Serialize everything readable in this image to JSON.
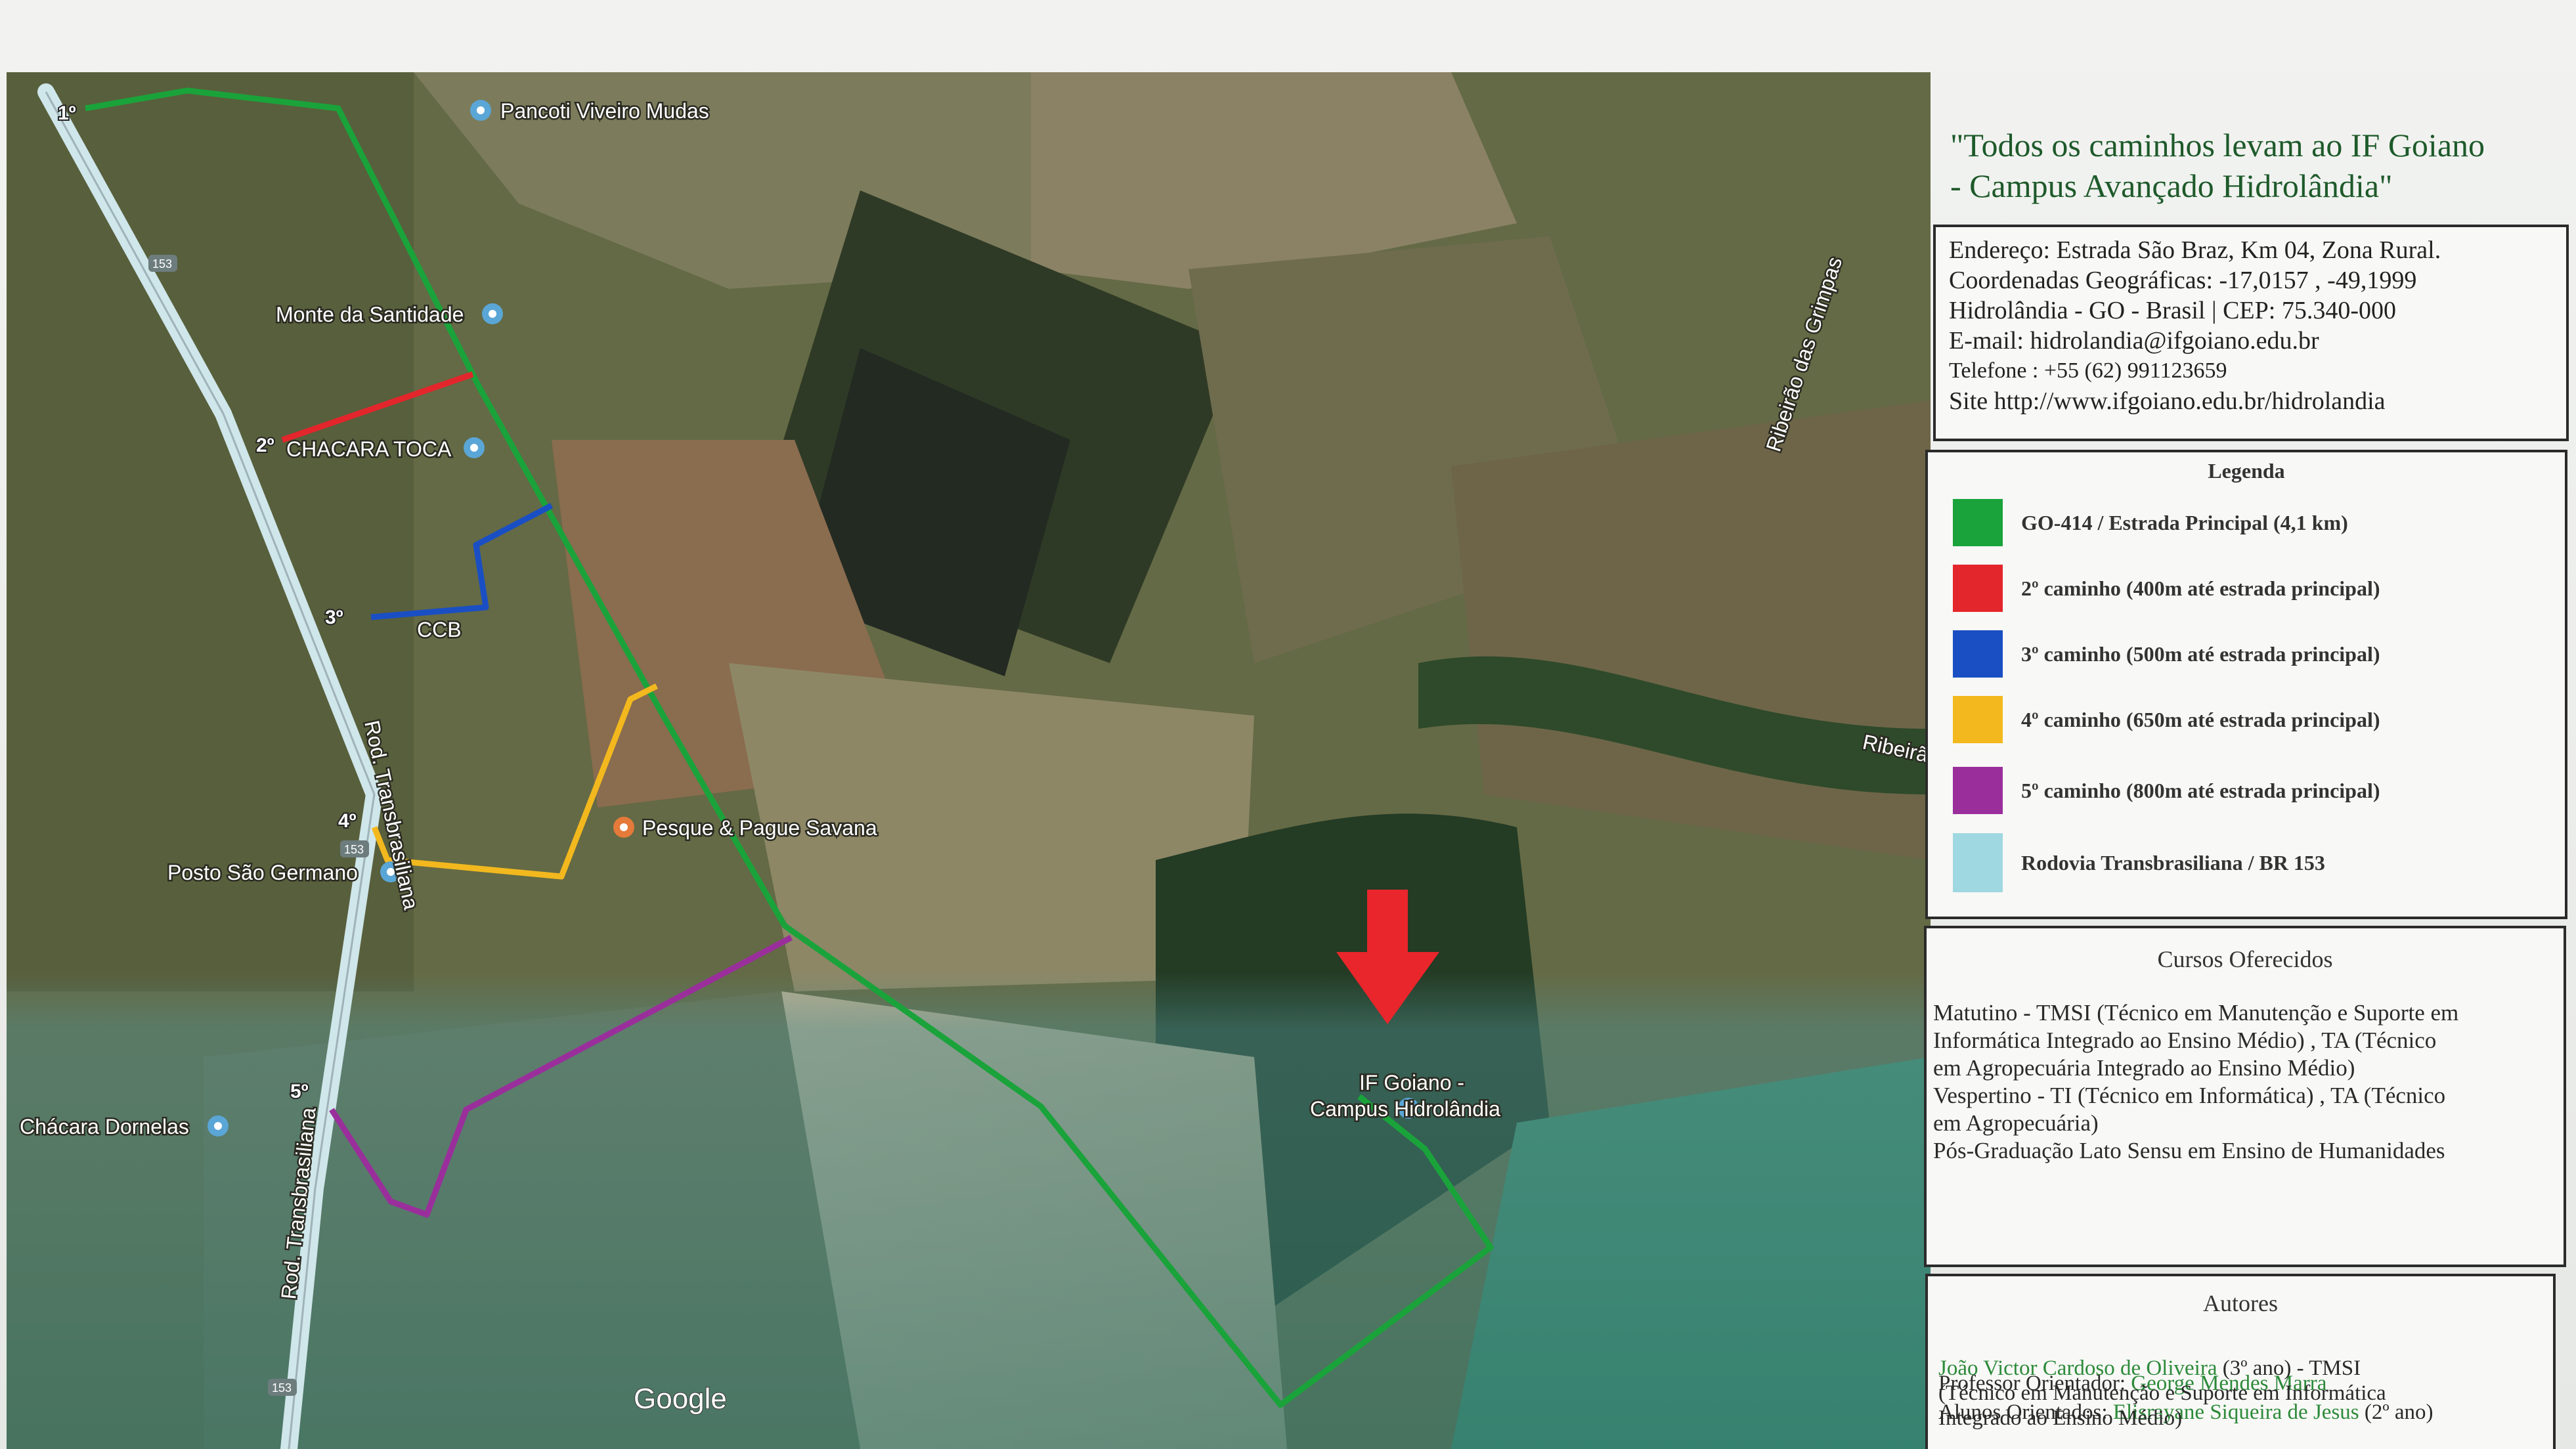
{
  "map": {
    "watermark": "Google",
    "markers": [
      "1º",
      "2º",
      "3º",
      "4º",
      "5º"
    ],
    "places": {
      "pancoti": "Pancoti Viveiro Mudas",
      "monte": "Monte da Santidade",
      "chacara_toca": "CHACARA TOCA",
      "ccb": "CCB",
      "pesque": "Pesque & Pague Savana",
      "posto": "Posto São Germano",
      "dornelas": "Chácara Dornelas",
      "campus_l1": "IF Goiano -",
      "campus_l2": "Campus Hidrolândia",
      "ribeirao1": "Ribeirão das Grimpas",
      "ribeirao2": "Ribeirã",
      "rod1": "Rod. Transbrasiliana",
      "rod2": "Rod. Transbrasiliana"
    },
    "shields": [
      "153",
      "153",
      "153"
    ]
  },
  "panel": {
    "title_l1": "\"Todos os caminhos levam ao IF Goiano",
    "title_l2": "- Campus Avançado Hidrolândia\"",
    "address": [
      "Endereço: Estrada São Braz, Km 04, Zona Rural.",
      "Coordenadas Geográficas: -17,0157 , -49,1999",
      "Hidrolândia - GO - Brasil  |  CEP: 75.340-000",
      "E-mail: hidrolandia@ifgoiano.edu.br",
      "Telefone : +55 (62) 991123659",
      "Site http://www.ifgoiano.edu.br/hidrolandia"
    ],
    "legend": {
      "heading": "Legenda",
      "items": [
        {
          "label": "GO-414 / Estrada Principal (4,1 km)",
          "color": "#1aa33a"
        },
        {
          "label": "2º caminho (400m até estrada principal)",
          "color": "#e3262c"
        },
        {
          "label": "3º caminho (500m até estrada principal)",
          "color": "#1a4fc4"
        },
        {
          "label": "4º caminho (650m até estrada principal)",
          "color": "#f2b81e"
        },
        {
          "label": "5º caminho (800m até estrada principal)",
          "color": "#9a2f9c"
        },
        {
          "label": "Rodovia Transbrasiliana / BR 153",
          "color": "#9fd8e0"
        }
      ]
    },
    "courses": {
      "heading": "Cursos Oferecidos",
      "lines": [
        "Matutino - TMSI (Técnico em Manutenção e Suporte em",
        "Informática Integrado ao Ensino Médio) , TA (Técnico",
        "em Agropecuária Integrado ao Ensino Médio)",
        "Vespertino - TI (Técnico em Informática) , TA (Técnico",
        "em Agropecuária)",
        "Pós-Graduação Lato Sensu em Ensino de Humanidades"
      ]
    },
    "authors": {
      "heading": "Autores",
      "advisor_prefix": "Professor Orientador: ",
      "advisor_name": "George Mendes Marra",
      "students_prefix": "Alunos Orientados: ",
      "student1_name": "Elisrayane Siqueira de Jesus",
      "student1_suffix": " (2º ano)",
      "student2_name": "João Victor Cardoso de Oliveira",
      "student2_suffix": " (3º ano) - TMSI",
      "line4": "(Técnico em Manutenção e Suporte em Informática",
      "line5": "Integrado ao Ensino Médio)"
    }
  },
  "colors": {
    "main_road": "#1aa33a",
    "path2": "#e3262c",
    "path3": "#1a4fc4",
    "path4": "#f2b81e",
    "path5": "#9a2f9c",
    "arrow": "#e8262b",
    "title": "#1e5a2a"
  }
}
